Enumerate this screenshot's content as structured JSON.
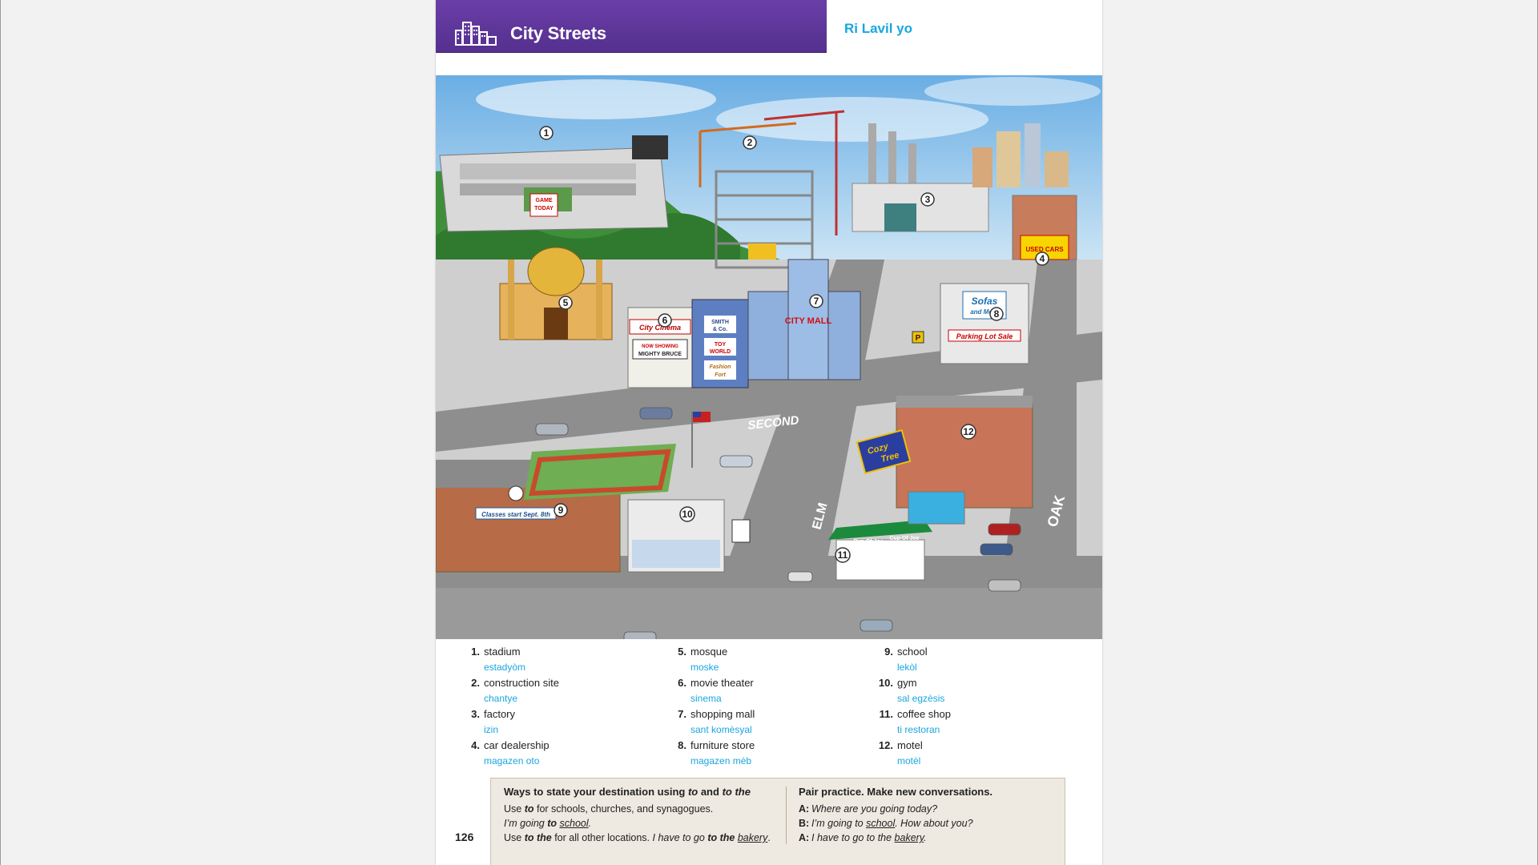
{
  "header": {
    "title": "City Streets",
    "subtitle": "Ri Lavil yo",
    "icon": "city-buildings-icon",
    "accent_color": "#5b3396",
    "subtitle_color": "#19a6df"
  },
  "illustration": {
    "signs": {
      "game_today_1": "GAME",
      "game_today_2": "TODAY",
      "used_cars": "USED CARS",
      "city_cinema": "City Cinema",
      "now_showing": "NOW SHOWING",
      "mighty_bruce": "MIGHTY BRUCE",
      "smith_1": "SMITH",
      "smith_2": "& Co.",
      "toy_1": "TOY",
      "toy_2": "WORLD",
      "fashion_1": "Fashion",
      "fashion_2": "Fort",
      "city_mall": "CITY MALL",
      "sofas": "Sofas",
      "and_more": "and More",
      "parking_lot_sale": "Parking Lot Sale",
      "cozy": "Cozy",
      "tree": "Tree",
      "classes_start": "Classes start Sept. 8th",
      "cup_of_joe": "Cup Of Joe",
      "p_sign": "P"
    },
    "streets": {
      "second": "SECOND",
      "elm": "ELM",
      "oak": "OAK"
    },
    "markers": [
      "1",
      "2",
      "3",
      "4",
      "5",
      "6",
      "7",
      "8",
      "9",
      "10",
      "11",
      "12"
    ]
  },
  "vocabulary": [
    {
      "num": "1.",
      "word": "stadium",
      "translation": "estadyòm"
    },
    {
      "num": "2.",
      "word": "construction site",
      "translation": "chantye"
    },
    {
      "num": "3.",
      "word": "factory",
      "translation": "izin"
    },
    {
      "num": "4.",
      "word": "car dealership",
      "translation": "magazen oto"
    },
    {
      "num": "5.",
      "word": "mosque",
      "translation": "moske"
    },
    {
      "num": "6.",
      "word": "movie theater",
      "translation": "sinema"
    },
    {
      "num": "7.",
      "word": "shopping mall",
      "translation": "sant komèsyal"
    },
    {
      "num": "8.",
      "word": "furniture store",
      "translation": "magazen mèb"
    },
    {
      "num": "9.",
      "word": "school",
      "translation": "lekòl"
    },
    {
      "num": "10.",
      "word": "gym",
      "translation": "sal egzèsis"
    },
    {
      "num": "11.",
      "word": "coffee shop",
      "translation": "ti restoran"
    },
    {
      "num": "12.",
      "word": "motel",
      "translation": "motèl"
    }
  ],
  "grammar_box": {
    "heading_pre": "Ways to state your destination using ",
    "heading_to": "to",
    "heading_and": " and ",
    "heading_to_the": "to the",
    "rule1_use": "Use ",
    "rule1_to": "to",
    "rule1_rest": " for schools, churches, and synagogues.",
    "ex1_pre": "I’m going ",
    "ex1_to": "to",
    "ex1_place": "school",
    "ex1_end": ".",
    "rule2_use": "Use ",
    "rule2_to_the": "to the",
    "rule2_rest": " for all other locations. ",
    "ex2_pre": "I have to go ",
    "ex2_to_the": "to the",
    "ex2_place": "bakery",
    "ex2_end": "."
  },
  "practice_box": {
    "heading": "Pair practice. Make new conversations.",
    "line1_speaker": "A:",
    "line1_text": "Where are you going today?",
    "line2_speaker": "B:",
    "line2_pre": "I’m going to ",
    "line2_place": "school",
    "line2_post": ". How about you?",
    "line3_speaker": "A:",
    "line3_pre": "I have to go to the ",
    "line3_place": "bakery",
    "line3_end": "."
  },
  "page_number": "126"
}
